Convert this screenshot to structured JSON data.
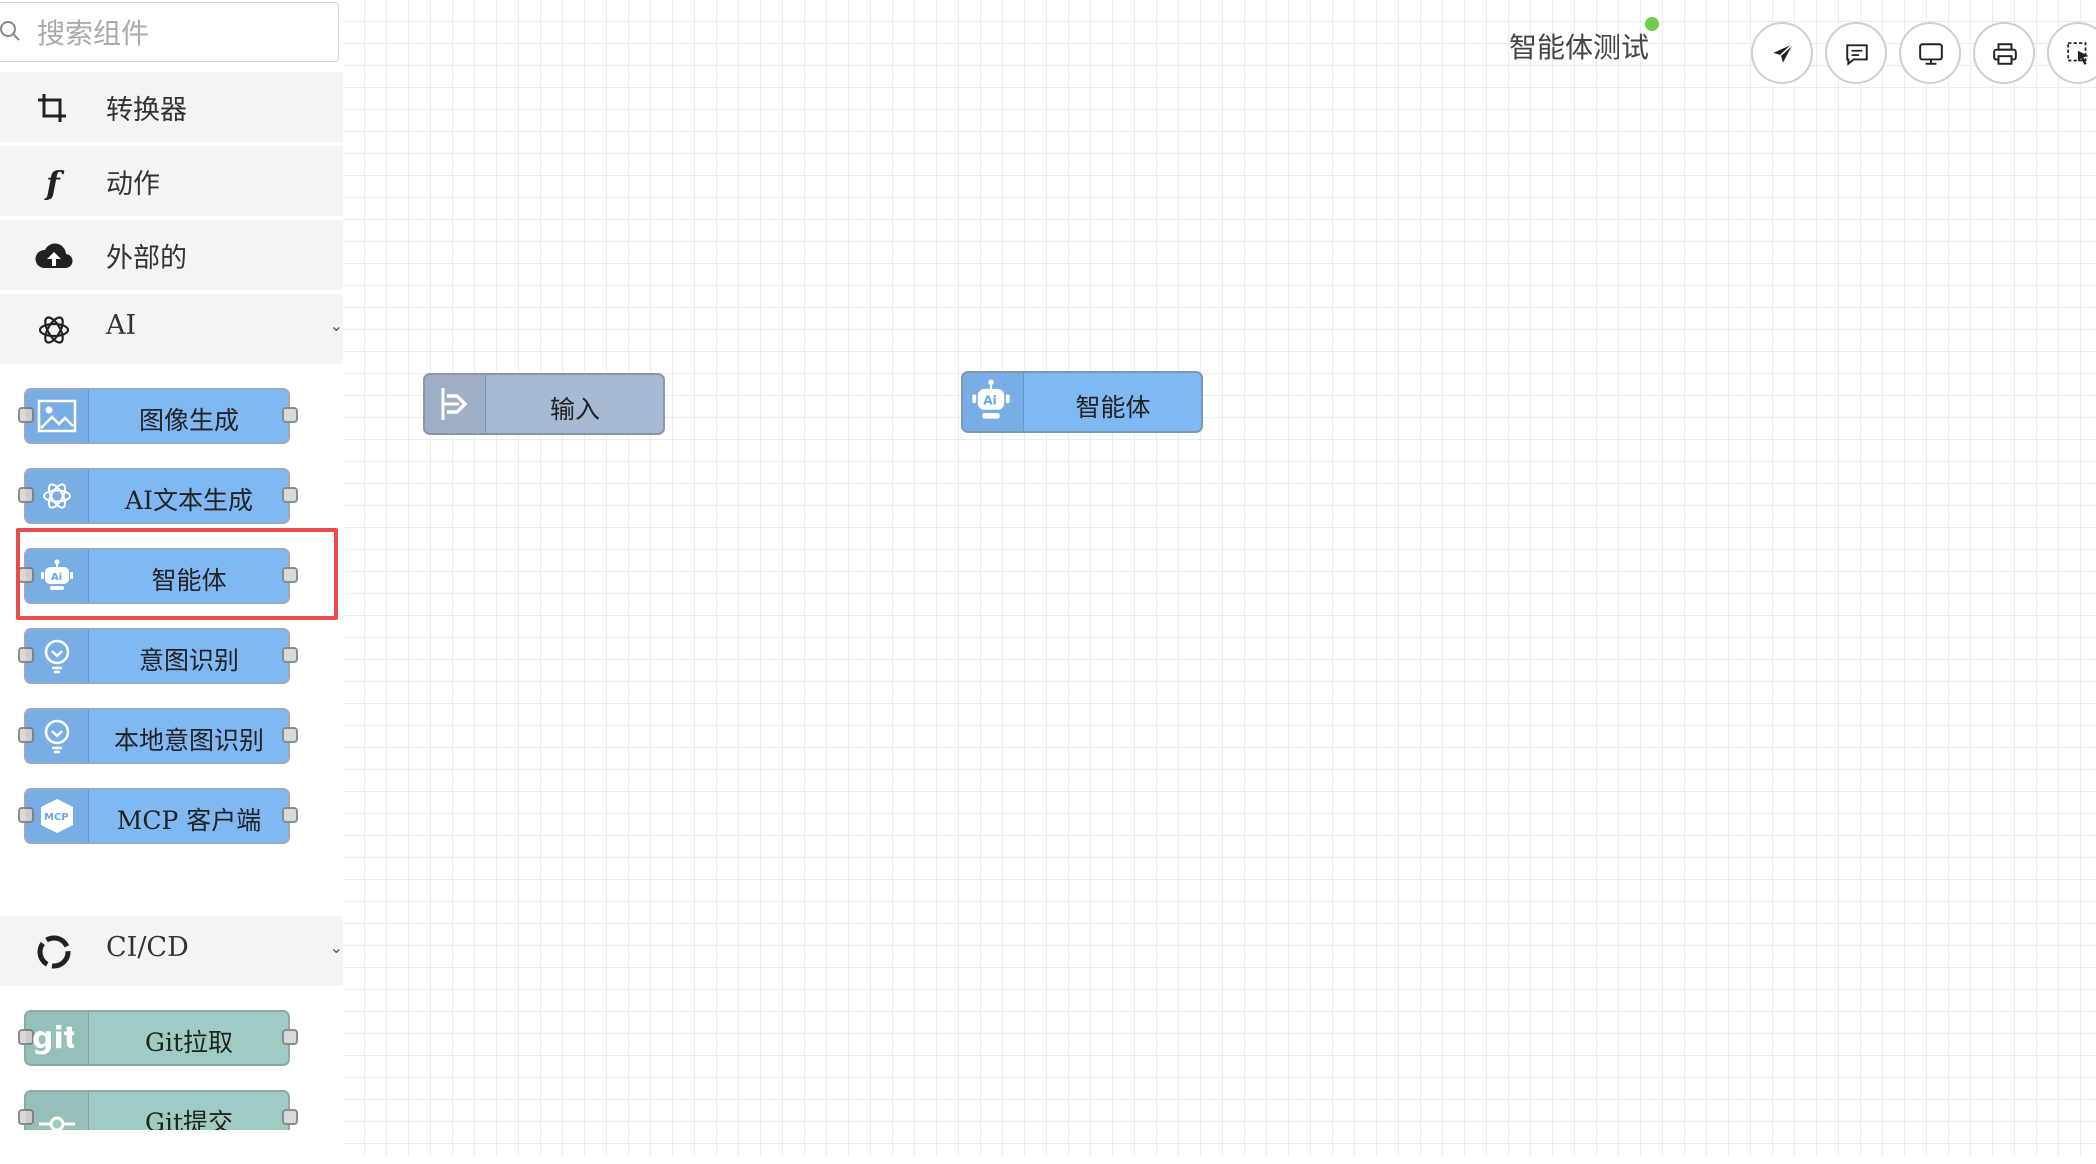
{
  "search": {
    "placeholder": "搜索组件"
  },
  "categories": {
    "converter": "转换器",
    "action": "动作",
    "external": "外部的",
    "ai": "AI",
    "cicd": "CI/CD"
  },
  "ai_nodes": [
    {
      "label": "图像生成",
      "icon": "image-icon"
    },
    {
      "label": "AI文本生成",
      "icon": "openai-icon"
    },
    {
      "label": "智能体",
      "icon": "robot-icon"
    },
    {
      "label": "意图识别",
      "icon": "lightbulb-icon"
    },
    {
      "label": "本地意图识别",
      "icon": "lightbulb-icon"
    },
    {
      "label": "MCP 客户端",
      "icon": "mcp-icon"
    }
  ],
  "cicd_nodes": [
    {
      "label": "Git拉取",
      "icon": "git-icon"
    },
    {
      "label": "Git提交",
      "icon": "git-commit-icon"
    }
  ],
  "canvas": {
    "title": "智能体测试",
    "status_color": "#6dcc4a",
    "nodes": [
      {
        "label": "输入",
        "icon": "input-arrow-icon",
        "color": "#a7b9d2"
      },
      {
        "label": "智能体",
        "icon": "robot-icon",
        "color": "#80b8f4"
      }
    ]
  },
  "toolbar": {
    "buttons": [
      "send-icon",
      "comment-icon",
      "monitor-icon",
      "print-icon",
      "select-icon"
    ]
  },
  "colors": {
    "ai_node": "#80b8f4",
    "cicd_node": "#9fcbc5",
    "highlight": "#e84d4d"
  }
}
